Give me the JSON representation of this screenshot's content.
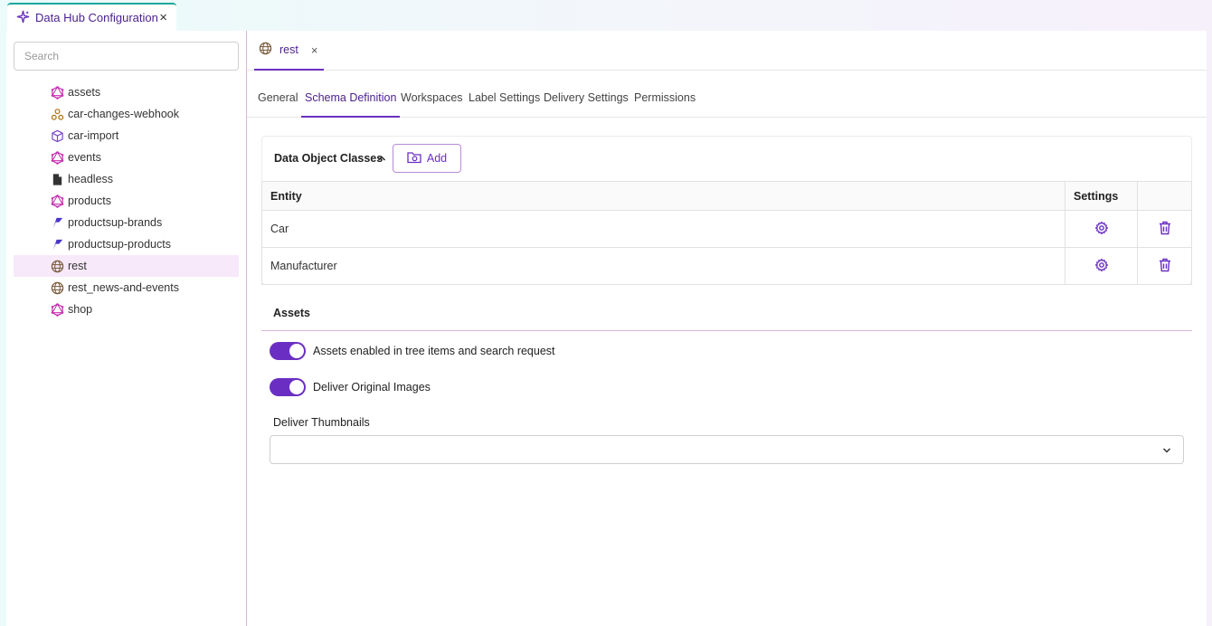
{
  "app_tab": {
    "title": "Data Hub Configuration",
    "close": "×",
    "icon": "data-hub-sparkle-icon"
  },
  "sidebar": {
    "search_placeholder": "Search",
    "items": [
      {
        "label": "assets",
        "icon": "graphql-icon"
      },
      {
        "label": "car-changes-webhook",
        "icon": "webhook-icon"
      },
      {
        "label": "car-import",
        "icon": "cube-icon"
      },
      {
        "label": "events",
        "icon": "graphql-icon"
      },
      {
        "label": "headless",
        "icon": "file-icon"
      },
      {
        "label": "products",
        "icon": "graphql-icon"
      },
      {
        "label": "productsup-brands",
        "icon": "productsup-icon"
      },
      {
        "label": "productsup-products",
        "icon": "productsup-icon"
      },
      {
        "label": "rest",
        "icon": "globe-icon",
        "selected": true
      },
      {
        "label": "rest_news-and-events",
        "icon": "globe-icon"
      },
      {
        "label": "shop",
        "icon": "graphql-icon"
      }
    ]
  },
  "doc_tab": {
    "label": "rest",
    "close": "×",
    "icon": "globe-icon"
  },
  "sub_tabs": [
    {
      "label": "General"
    },
    {
      "label": "Schema Definition",
      "active": true
    },
    {
      "label": "Workspaces"
    },
    {
      "label": "Label Settings"
    },
    {
      "label": "Delivery Settings"
    },
    {
      "label": "Permissions"
    }
  ],
  "data_object_classes": {
    "title": "Data Object Classes",
    "add_label": "Add",
    "columns": [
      "Entity",
      "Settings",
      ""
    ],
    "rows": [
      {
        "entity": "Car"
      },
      {
        "entity": "Manufacturer"
      }
    ]
  },
  "assets": {
    "title": "Assets",
    "toggle1_label": "Assets enabled in tree items and search request",
    "toggle1_on": true,
    "toggle2_label": "Deliver Original Images",
    "toggle2_on": true,
    "thumbnails_label": "Deliver Thumbnails",
    "thumbnails_value": ""
  },
  "colors": {
    "accent": "#6a2fc2",
    "accent_dark": "#4a1f8f",
    "selected_bg": "#f7e9fa",
    "graphql": "#c62fb0",
    "top_border": "#1aa89a"
  }
}
